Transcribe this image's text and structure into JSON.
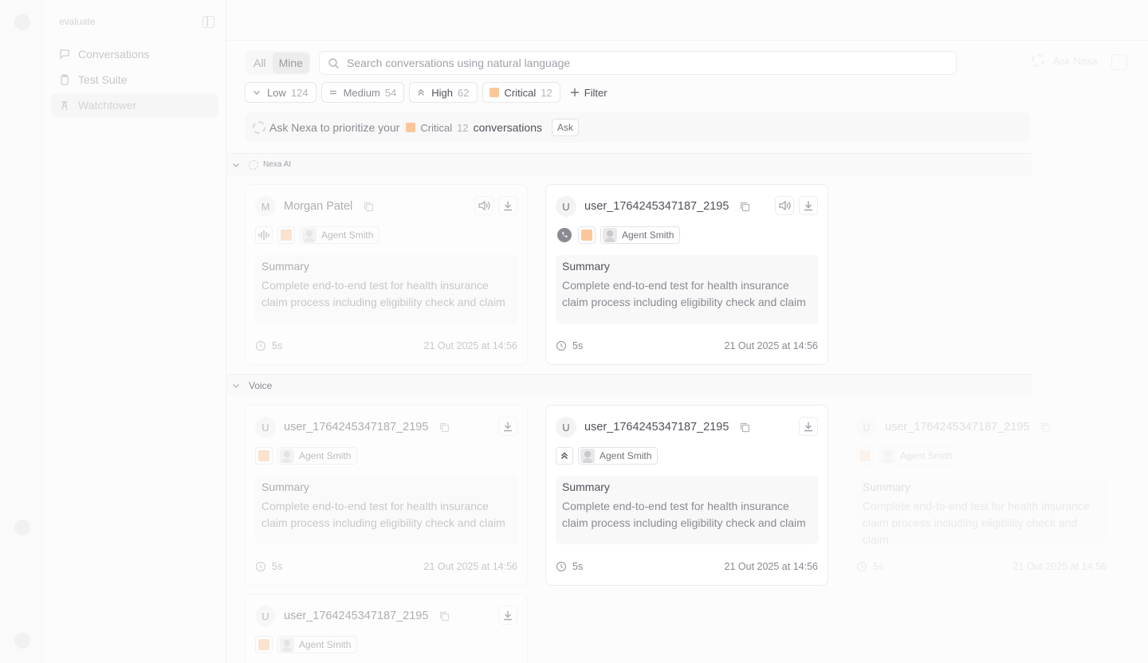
{
  "sidebar": {
    "brand": "evaluate",
    "items": [
      {
        "label": "Conversations",
        "icon": "message-icon"
      },
      {
        "label": "Test Suite",
        "icon": "clipboard-icon"
      },
      {
        "label": "Watchtower",
        "icon": "tower-icon"
      }
    ]
  },
  "toolbar": {
    "scope_all": "All",
    "scope_mine": "Mine",
    "search_placeholder": "Search conversations using natural language",
    "ask_nexa": "Ask Nexa"
  },
  "filters": [
    {
      "label": "Low",
      "count": "124",
      "icon": "chevron-down-icon"
    },
    {
      "label": "Medium",
      "count": "54",
      "icon": "equals-icon"
    },
    {
      "label": "High",
      "count": "62",
      "icon": "chevrons-up-icon"
    },
    {
      "label": "Critical",
      "count": "12",
      "icon": "critical-square-icon",
      "color": "#fbc79a"
    }
  ],
  "filter_button": "Filter",
  "banner": {
    "prefix": "Ask Nexa to prioritize your",
    "label": "Critical",
    "count": "12",
    "suffix": "conversations",
    "ask": "Ask"
  },
  "groups": {
    "ai_label": "Nexa AI",
    "voice_label": "Voice"
  },
  "cards": [
    {
      "initial": "M",
      "name": "Morgan Patel",
      "agent": "Agent Smith",
      "summary_title": "Summary",
      "summary": "Complete end-to-end test for health insurance claim process including eligibility check and claim",
      "duration": "5s",
      "date": "21 Out 2025 at 14:56"
    },
    {
      "initial": "U",
      "name": "user_1764245347187_2195",
      "agent": "Agent Smith",
      "summary_title": "Summary",
      "summary": "Complete end-to-end test for health insurance claim process including eligibility check and claim",
      "duration": "5s",
      "date": "21 Out 2025 at 14:56"
    },
    {
      "initial": "U",
      "name": "user_1764245347187_2195",
      "agent": "Agent Smith",
      "summary_title": "Summary",
      "summary": "Complete end-to-end test for health insurance claim process including eligibility check and claim",
      "duration": "5s",
      "date": "21 Out 2025 at 14:56"
    },
    {
      "initial": "U",
      "name": "user_1764245347187_2195",
      "agent": "Agent Smith",
      "summary_title": "Summary",
      "summary": "Complete end-to-end test for health insurance claim process including eligibility check and claim",
      "duration": "5s",
      "date": "21 Out 2025 at 14:56"
    },
    {
      "initial": "U",
      "name": "user_1764245347187_2195",
      "agent": "Agent Smith",
      "summary_title": "Summary",
      "summary": "Complete end-to-end test for health insurance claim process including eligibility check and claim",
      "duration": "5s",
      "date": "21 Out 2025 at 14:56"
    },
    {
      "initial": "U",
      "name": "user_1764245347187_2195",
      "agent": "Agent Smith"
    }
  ]
}
